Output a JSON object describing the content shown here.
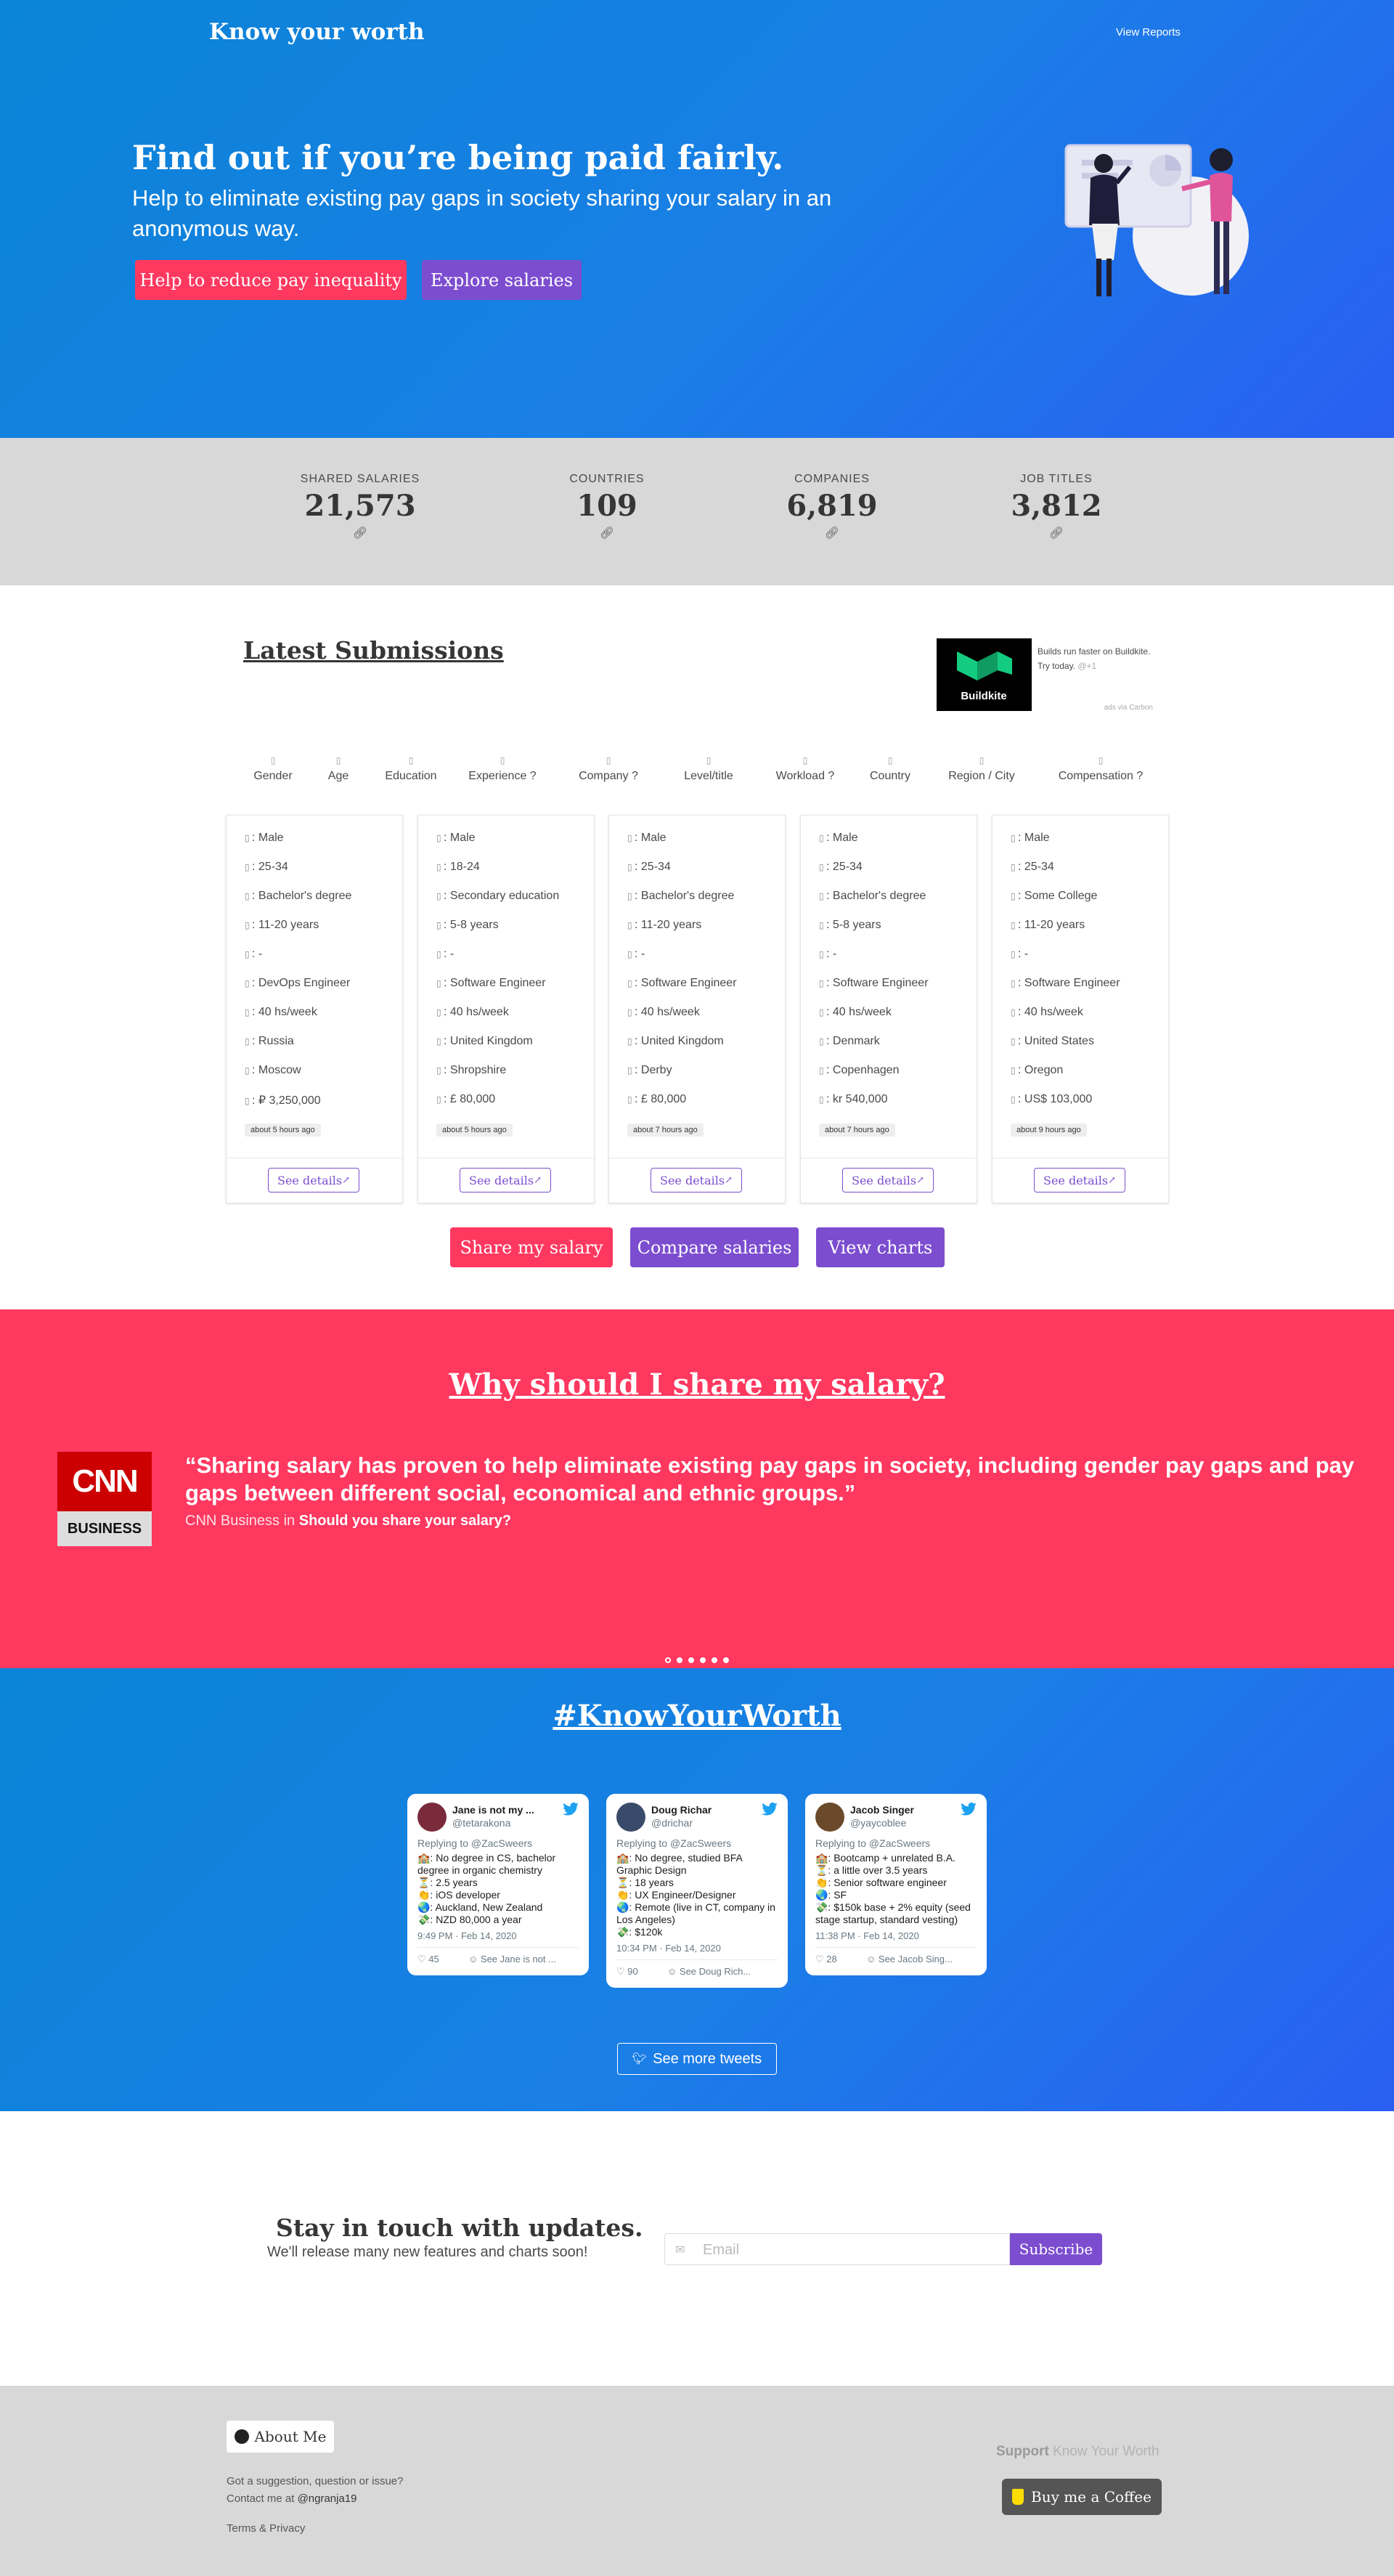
{
  "header": {
    "brand": "Know your worth",
    "nav_reports": "View Reports"
  },
  "hero": {
    "title": "Find out if you’re being paid fairly.",
    "subtitle": "Help to eliminate existing pay gaps in society sharing your salary in an anonymous way.",
    "btn_reduce": "Help to reduce pay inequality",
    "btn_explore": "Explore salaries"
  },
  "stats": [
    {
      "label": "Shared Salaries",
      "value": "21,573"
    },
    {
      "label": "Countries",
      "value": "109"
    },
    {
      "label": "Companies",
      "value": "6,819"
    },
    {
      "label": "Job Titles",
      "value": "3,812"
    }
  ],
  "latest": {
    "title": "Latest Submissions",
    "ad": {
      "logo_text": "Buildkite",
      "text": "Builds run faster on Buildkite. Try today.",
      "extra": "@+1",
      "via": "ads via Carbon"
    },
    "filters": [
      {
        "label": "Gender",
        "help": ""
      },
      {
        "label": "Age",
        "help": ""
      },
      {
        "label": "Education",
        "help": ""
      },
      {
        "label": "Experience",
        "help": "?"
      },
      {
        "label": "Company",
        "help": "?"
      },
      {
        "label": "Level/title",
        "help": ""
      },
      {
        "label": "Workload",
        "help": "?"
      },
      {
        "label": "Country",
        "help": ""
      },
      {
        "label": "Region / City",
        "help": ""
      },
      {
        "label": "Compensation",
        "help": "?"
      }
    ],
    "cards": [
      {
        "rows": [
          ": Male",
          ": 25-34",
          ": Bachelor's degree",
          ": 11-20 years",
          ": -",
          ": DevOps Engineer",
          ": 40 hs/week",
          ": Russia",
          ": Moscow",
          ": ₽ 3,250,000"
        ],
        "time": "about 5 hours ago",
        "details": "See details"
      },
      {
        "rows": [
          ": Male",
          ": 18-24",
          ": Secondary education",
          ": 5-8 years",
          ": -",
          ": Software Engineer",
          ": 40 hs/week",
          ": United Kingdom",
          ": Shropshire",
          ": £ 80,000"
        ],
        "time": "about 5 hours ago",
        "details": "See details"
      },
      {
        "rows": [
          ": Male",
          ": 25-34",
          ": Bachelor's degree",
          ": 11-20 years",
          ": -",
          ": Software Engineer",
          ": 40 hs/week",
          ": United Kingdom",
          ": Derby",
          ": £ 80,000"
        ],
        "time": "about 7 hours ago",
        "details": "See details"
      },
      {
        "rows": [
          ": Male",
          ": 25-34",
          ": Bachelor's degree",
          ": 5-8 years",
          ": -",
          ": Software Engineer",
          ": 40 hs/week",
          ": Denmark",
          ": Copenhagen",
          ": kr 540,000"
        ],
        "time": "about 7 hours ago",
        "details": "See details"
      },
      {
        "rows": [
          ": Male",
          ": 25-34",
          ": Some College",
          ": 11-20 years",
          ": -",
          ": Software Engineer",
          ": 40 hs/week",
          ": United States",
          ": Oregon",
          ": US$ 103,000"
        ],
        "time": "about 9 hours ago",
        "details": "See details"
      }
    ],
    "btn_share": "Share my salary",
    "btn_compare": "Compare salaries",
    "btn_charts": "View charts"
  },
  "why": {
    "title": "Why should I share my salary?",
    "logo_top": "CNN",
    "logo_bottom": "BUSINESS",
    "quote": "“Sharing salary has proven to help eliminate existing pay gaps in society, including gender pay gaps and pay gaps between different social, economical and ethnic groups.”",
    "source_prefix": "CNN Business in",
    "source_title": "Should you share your salary?"
  },
  "tweets_section": {
    "title": "#KnowYourWorth",
    "tweets": [
      {
        "name": "Jane is not my ...",
        "handle": "@tetarakona",
        "reply": "Replying to @ZacSweers",
        "body": "🏫: No degree in CS, bachelor degree in organic chemistry\n⏳: 2.5 years\n👏: iOS developer\n🌏: Auckland, New Zealand\n💸: NZD 80,000 a year",
        "time": "9:49 PM · Feb 14, 2020",
        "likes": "45",
        "see": "See Jane is not ..."
      },
      {
        "name": "Doug Richar",
        "handle": "@drichar",
        "reply": "Replying to @ZacSweers",
        "body": "🏫: No degree, studied BFA Graphic Design\n⏳: 18 years\n👏: UX Engineer/Designer\n🌏: Remote (live in CT, company in Los Angeles)\n💸: $120k",
        "time": "10:34 PM · Feb 14, 2020",
        "likes": "90",
        "see": "See Doug Rich..."
      },
      {
        "name": "Jacob Singer",
        "handle": "@yaycoblee",
        "reply": "Replying to @ZacSweers",
        "body": "🏫: Bootcamp + unrelated B.A.\n⏳: a little over 3.5 years\n👏: Senior software engineer\n🌏: SF\n💸: $150k base + 2% equity (seed stage startup, standard vesting)",
        "time": "11:38 PM · Feb 14, 2020",
        "likes": "28",
        "see": "See Jacob Sing..."
      }
    ],
    "btn_more": "See more tweets"
  },
  "newsletter": {
    "title": "Stay in touch with updates.",
    "subtitle": "We'll release many new features and charts soon!",
    "placeholder": "Email",
    "btn_subscribe": "Subscribe"
  },
  "footer": {
    "about": "About Me",
    "suggest_line1": "Got a suggestion, question or issue?",
    "suggest_line2_prefix": "Contact me at",
    "suggest_handle": "@ngranja19",
    "terms": "Terms & Privacy",
    "support_prefix": "Support",
    "support_name": "Know Your Worth",
    "coffee": "Buy me a Coffee"
  },
  "colors": {
    "brand_blue": "#1a7fe6",
    "pink": "#ff3860",
    "purple": "#7c4dcf"
  }
}
